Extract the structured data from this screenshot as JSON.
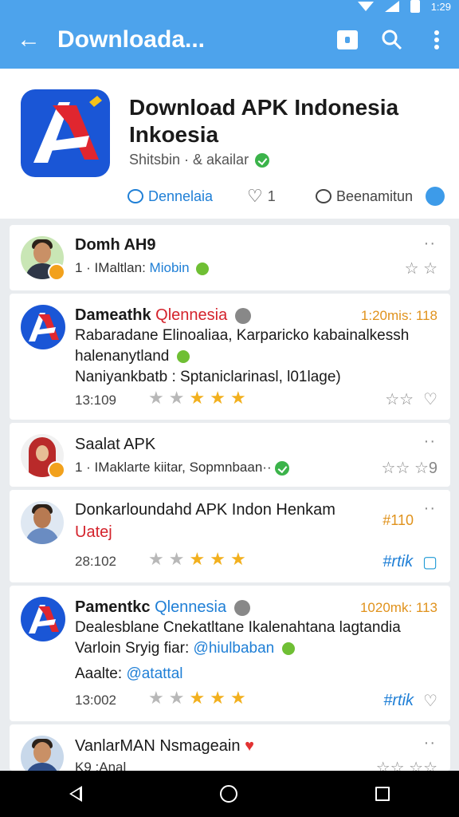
{
  "appbar": {
    "title": "Downloada...",
    "status_time": "1:29",
    "back_icon": "arrow-back-icon",
    "icons": [
      "lock-icon",
      "search-icon",
      "more-vert-icon"
    ]
  },
  "header": {
    "title": "Download APK Indonesia Inkoesia",
    "subtitle": "Shitsbin · & akailar",
    "actions": [
      {
        "label": "Dennelaia",
        "icon": "comment-icon"
      },
      {
        "label": "1",
        "icon": "heart-icon"
      },
      {
        "label": "Beenamitun",
        "icon": "comment-icon"
      }
    ]
  },
  "posts": [
    {
      "name": "Domh AH9",
      "meta_prefix": "1 · IMaltlan:",
      "meta_link": "Miobin",
      "star_glyphs": "☆ ☆",
      "more": "··"
    },
    {
      "name": "Dameathk",
      "name_tag": "Qlennesia",
      "right_label": "1:20mis: 118",
      "body": [
        "Rabaradane Elinoaliaa, Karparicko kabainalkessh",
        "halenanytland",
        "Naniyankbatb : Sptaniclarinasl, l01lage)"
      ],
      "time": "13:109",
      "rating": 3.5
    },
    {
      "name": "Saalat APK",
      "meta_prefix": "1 · IMaklarte kiitar, Sopmnbaan··",
      "more": "··",
      "right_icon_text": "☆☆ ☆9"
    },
    {
      "name": "Donkarloundahd APK Indon Henkam",
      "name_line2": "Uatej",
      "right_label": "#110",
      "time": "28:102",
      "rating": 3.5,
      "right_link": "#rtik"
    },
    {
      "name": "Pamentkc",
      "name_tag": "Qlennesia",
      "right_label": "1020mk: 113",
      "body": [
        "Dealesblane Cnekatltane Ikalenahtana lagtandia",
        "Varloin Sryig fiar:"
      ],
      "body_link": "@hiulbaban",
      "extra_prefix": "Aaalte:",
      "extra_link": "@atattal",
      "time": "13:002",
      "rating": 3.5,
      "right_link": "#rtik"
    },
    {
      "name": "VanlarMAN Nsmageain",
      "meta_prefix": "K9 :Anal",
      "more": "··"
    }
  ],
  "navbar": {
    "icons": [
      "nav-back-icon",
      "nav-home-icon",
      "nav-recents-icon"
    ]
  },
  "colors": {
    "appbar": "#4da3ec",
    "accent_blue": "#1f7fd6",
    "star": "#f2b01e",
    "orange_label": "#e0921c"
  }
}
